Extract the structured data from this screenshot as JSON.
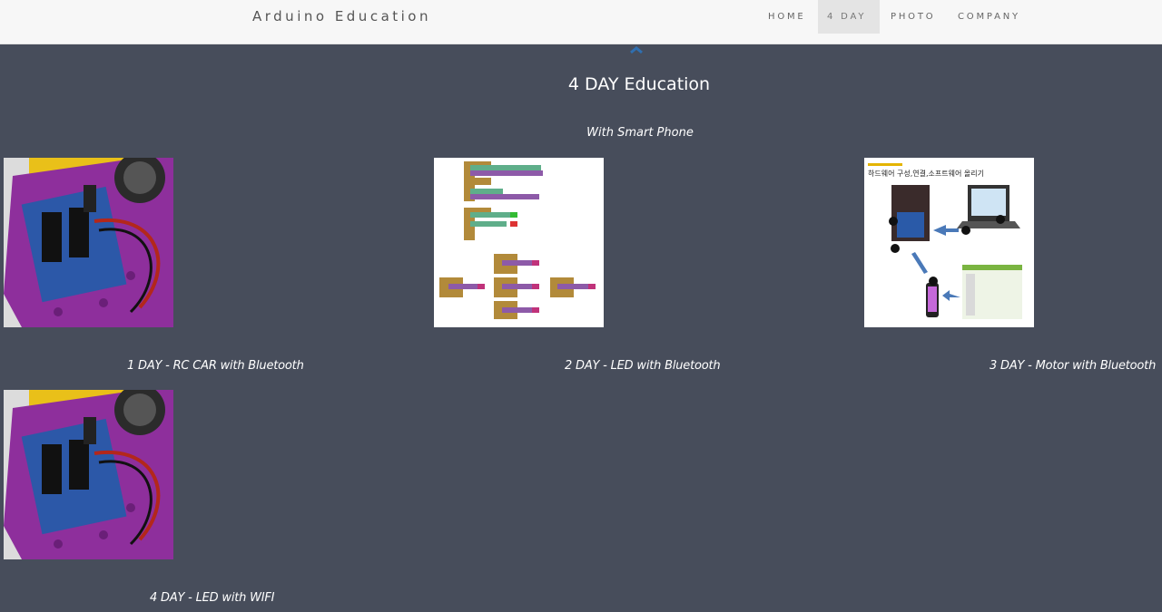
{
  "header": {
    "brand": "Arduino Education",
    "nav": [
      {
        "label": "HOME",
        "active": false
      },
      {
        "label": "4 DAY",
        "active": true
      },
      {
        "label": "PHOTO",
        "active": false
      },
      {
        "label": "COMPANY",
        "active": false
      }
    ]
  },
  "main": {
    "title": "4 DAY Education",
    "subtitle": "With Smart Phone",
    "cards": [
      {
        "caption": "1 DAY - RC CAR with Bluetooth",
        "image": "rc-car-photo"
      },
      {
        "caption": "2 DAY - LED with Bluetooth",
        "image": "block-code-screenshot"
      },
      {
        "caption": "3 DAY - Motor with Bluetooth",
        "image": "hardware-diagram",
        "image_heading": "하드웨어 구성,연결,소프트웨어 올리기"
      },
      {
        "caption": "4 DAY - LED with WIFI",
        "image": "rc-car-photo"
      }
    ]
  },
  "colors": {
    "background": "#474d5b",
    "header": "#f7f7f7",
    "accent": "#2f6fb0",
    "text": "#ffffff"
  }
}
